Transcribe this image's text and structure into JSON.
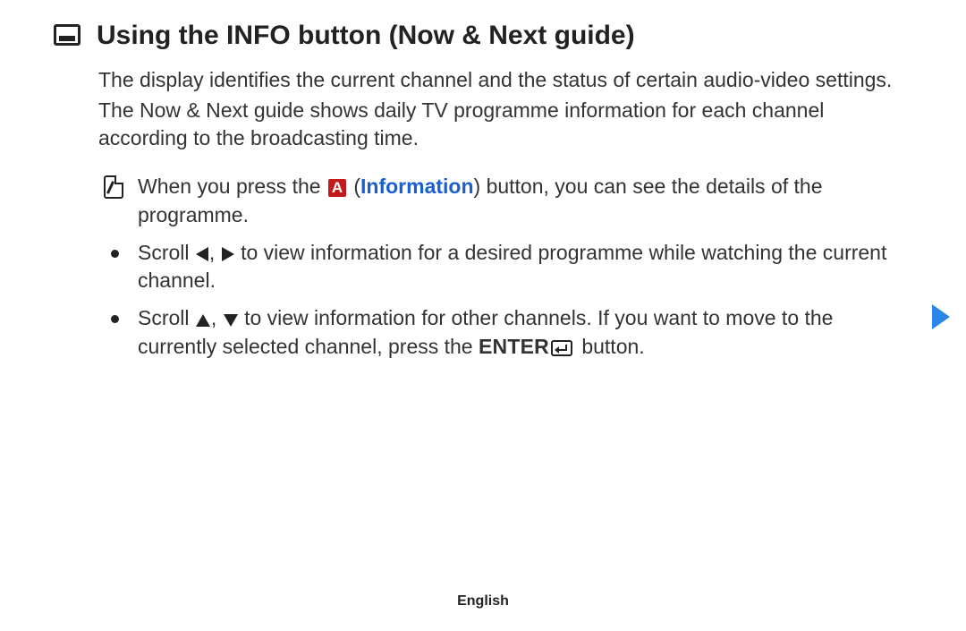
{
  "heading": "Using the INFO button (Now & Next guide)",
  "para1": "The display identifies the current channel and the status of certain audio-video settings.",
  "para2": "The Now & Next guide shows daily TV programme information for each channel according to the broadcasting time.",
  "note": {
    "pre": "When you press the ",
    "btnLetter": "A",
    "paren_open": " (",
    "info_word": "Information",
    "post": ") button, you can see the details of the programme."
  },
  "bullet1": {
    "pre": "Scroll ",
    "mid": ", ",
    "post": " to view information for a desired programme while watching the current channel."
  },
  "bullet2": {
    "pre": "Scroll ",
    "mid": ", ",
    "post1": " to view information for other channels. If you want to move to the currently selected channel, press the ",
    "enter": "ENTER",
    "post2": " button."
  },
  "footer": "English"
}
